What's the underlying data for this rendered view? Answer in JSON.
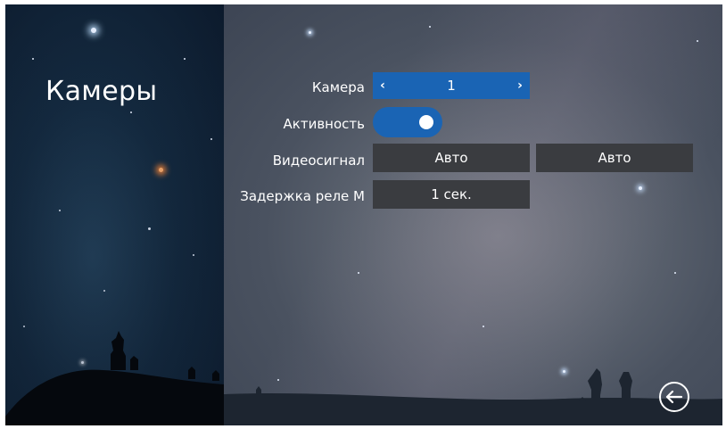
{
  "page": {
    "title": "Камеры"
  },
  "settings": {
    "camera": {
      "label": "Камера",
      "value": "1"
    },
    "activity": {
      "label": "Активность",
      "state": "on"
    },
    "video_signal": {
      "label": "Видеосигнал",
      "value_1": "Авто",
      "value_2": "Авто"
    },
    "relay_delay": {
      "label": "Задержка реле М",
      "value": "1 сек."
    }
  },
  "icons": {
    "prev": "chevron-left-icon",
    "next": "chevron-right-icon",
    "back": "back-arrow-icon"
  },
  "colors": {
    "accent": "#1a64b4",
    "field_bg": "#3a3c40",
    "text": "#ffffff"
  }
}
